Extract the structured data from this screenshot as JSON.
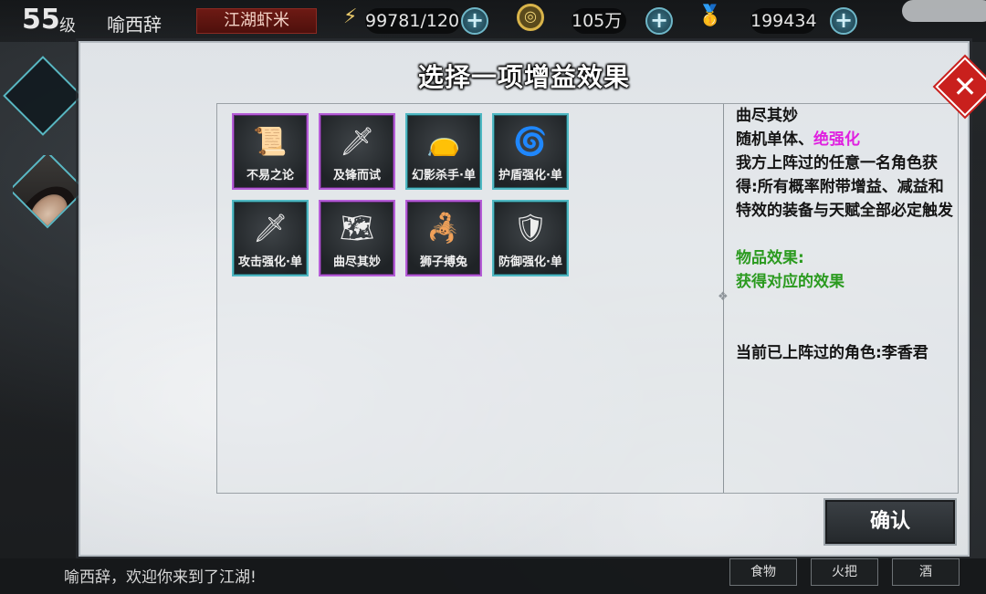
{
  "player": {
    "level": "55",
    "level_unit": "级",
    "name": "喻西辞",
    "rank": "江湖虾米"
  },
  "resources": {
    "stamina": "99781/120",
    "coins": "105万",
    "gold": "199434"
  },
  "dialog": {
    "title": "选择一项增益效果",
    "confirm_label": "确认"
  },
  "items": [
    {
      "label": "不易之论",
      "rarity": "purple",
      "icon": "bamboo-scroll-icon",
      "glyph": "📜"
    },
    {
      "label": "及锋而试",
      "rarity": "purple",
      "icon": "rifle-icon",
      "glyph": "🗡"
    },
    {
      "label": "幻影杀手·单",
      "rarity": "cyan",
      "icon": "cloth-pouch-icon",
      "glyph": "👝"
    },
    {
      "label": "护盾强化·单",
      "rarity": "cyan",
      "icon": "shield-orb-icon",
      "glyph": "🌀"
    },
    {
      "label": "攻击强化·单",
      "rarity": "cyan",
      "icon": "sword-icon",
      "glyph": "🗡"
    },
    {
      "label": "曲尽其妙",
      "rarity": "purple",
      "icon": "folding-screen-icon",
      "glyph": "🗺"
    },
    {
      "label": "狮子搏兔",
      "rarity": "purple",
      "icon": "scorpion-icon",
      "glyph": "🦂"
    },
    {
      "label": "防御强化·单",
      "rarity": "cyan",
      "icon": "armor-icon",
      "glyph": "🛡"
    }
  ],
  "description": {
    "name": "曲尽其妙",
    "target_prefix": "随机单体、",
    "target_highlight": "绝强化",
    "body": "我方上阵过的任意一名角色获得:所有概率附带增益、减益和特效的装备与天赋全部必定触发",
    "effect_heading": "物品效果:",
    "effect_text": "获得对应的效果",
    "deployed_label": "当前已上阵过的角色:李香君"
  },
  "bottom": {
    "welcome": "喻西辞，欢迎你来到了江湖!",
    "buttons": [
      "食物",
      "火把",
      "酒"
    ]
  },
  "colors": {
    "purple_rarity": "#b45cd6",
    "cyan_rarity": "#4fb8c3",
    "highlight_magenta": "#e020e0",
    "effect_green": "#2a9a1e",
    "close_red": "#c9201d"
  }
}
